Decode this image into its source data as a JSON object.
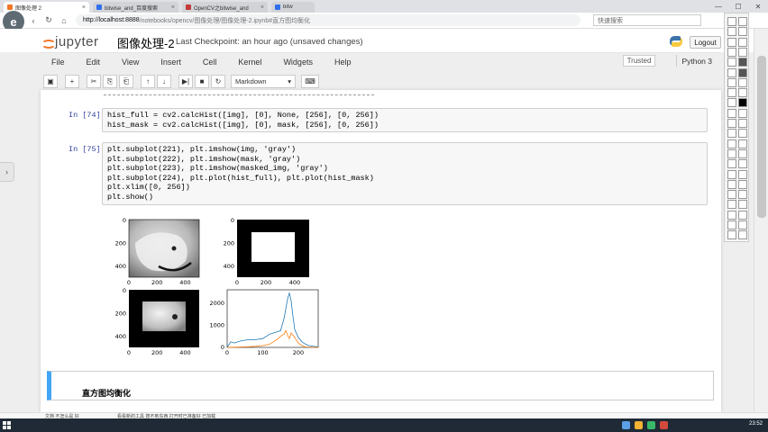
{
  "browser": {
    "tabs": [
      {
        "label": "图像处理 2",
        "active": true
      },
      {
        "label": "bitwise_and_百度搜索",
        "active": false
      },
      {
        "label": "OpenCV之bitwise_and",
        "active": false
      },
      {
        "label": "bitw",
        "active": false
      }
    ],
    "url_host": "http://localhost:8888",
    "url_path": "/notebooks/opencv/图像处理/图像处理-2.ipynb#直方图均衡化",
    "search_placeholder": "快速搜索",
    "close_glyph": "×",
    "nav_back": "‹",
    "nav_reload": "↻",
    "nav_home": "⌂",
    "min_glyph": "—",
    "max_glyph": "☐",
    "win_close_glyph": "✕"
  },
  "avatar_letter": "e",
  "jupyter": {
    "logo_text": "jupyter",
    "notebook_title": "图像处理-2",
    "checkpoint": "Last Checkpoint: an hour ago (unsaved changes)",
    "logout": "Logout",
    "menu": [
      "File",
      "Edit",
      "View",
      "Insert",
      "Cell",
      "Kernel",
      "Widgets",
      "Help"
    ],
    "trusted": "Trusted",
    "kernel": "Python 3",
    "cell_type": "Markdown",
    "toolbar_icons": [
      "save-icon",
      "plus-icon",
      "cut-icon",
      "copy-icon",
      "paste-icon",
      "up-arrow-icon",
      "down-arrow-icon",
      "run-icon",
      "stop-icon",
      "restart-icon",
      "keyboard-icon"
    ],
    "toolbar_glyphs": {
      "save": "▣",
      "add": "+",
      "cut": "✂",
      "copy": "⎘",
      "paste": "⎗",
      "up": "↑",
      "down": "↓",
      "run": "▶|",
      "stop": "■",
      "restart": "↻",
      "dropdown": "▾",
      "keyboard": "⌨"
    }
  },
  "cells": {
    "c1": {
      "prompt": "In [74]:",
      "lines": [
        "hist_full = cv2.calcHist([img], [0], None, [256], [0, 256])",
        "hist_mask = cv2.calcHist([img], [0], mask, [256], [0, 256])"
      ]
    },
    "c2": {
      "prompt": "In [75]:",
      "lines": [
        "plt.subplot(221), plt.imshow(img, 'gray')",
        "plt.subplot(222), plt.imshow(mask, 'gray')",
        "plt.subplot(223), plt.imshow(masked_img, 'gray')",
        "plt.subplot(224), plt.plot(hist_full), plt.plot(hist_mask)",
        "plt.xlim([0, 256])",
        "plt.show()"
      ]
    },
    "markdown": "直方图均衡化"
  },
  "chart_data": [
    {
      "type": "image",
      "panel": "img",
      "xticks": [
        "0",
        "200",
        "400"
      ],
      "yticks": [
        "0",
        "200",
        "400"
      ]
    },
    {
      "type": "image",
      "panel": "mask",
      "xticks": [
        "0",
        "200",
        "400"
      ],
      "yticks": [
        "0",
        "200",
        "400"
      ]
    },
    {
      "type": "image",
      "panel": "masked_img",
      "xticks": [
        "0",
        "200",
        "400"
      ],
      "yticks": [
        "0",
        "200",
        "400"
      ]
    },
    {
      "type": "line",
      "xlim": [
        0,
        256
      ],
      "ylim": [
        0,
        2600
      ],
      "xticks": [
        "0",
        "100",
        "200"
      ],
      "yticks": [
        "0",
        "1000",
        "2000"
      ],
      "series": [
        {
          "color": "#1f77b4",
          "x": [
            0,
            10,
            20,
            40,
            60,
            80,
            100,
            120,
            130,
            140,
            150,
            160,
            170,
            175,
            180,
            185,
            190,
            200,
            210,
            220,
            230,
            256
          ],
          "y": [
            0,
            250,
            200,
            300,
            350,
            350,
            400,
            600,
            650,
            700,
            750,
            1300,
            2200,
            2450,
            2100,
            1400,
            800,
            450,
            250,
            150,
            80,
            20
          ]
        },
        {
          "color": "#ff7f0e",
          "x": [
            0,
            20,
            40,
            60,
            80,
            100,
            120,
            130,
            140,
            150,
            160,
            165,
            170,
            175,
            180,
            190,
            200,
            210,
            220,
            256
          ],
          "y": [
            0,
            10,
            20,
            30,
            50,
            80,
            150,
            250,
            350,
            500,
            600,
            750,
            550,
            400,
            650,
            450,
            200,
            80,
            20,
            0
          ]
        }
      ]
    }
  ],
  "downloads": {
    "item": "文档 不怎么是 好",
    "status": "看看新的工具 按不到东西 打开时已准备好 已加载"
  },
  "taskbar": {
    "time": "23:52"
  },
  "colors": {
    "accent": "#f37726",
    "md_border": "#42a5f5",
    "prompt": "#303f9f"
  }
}
